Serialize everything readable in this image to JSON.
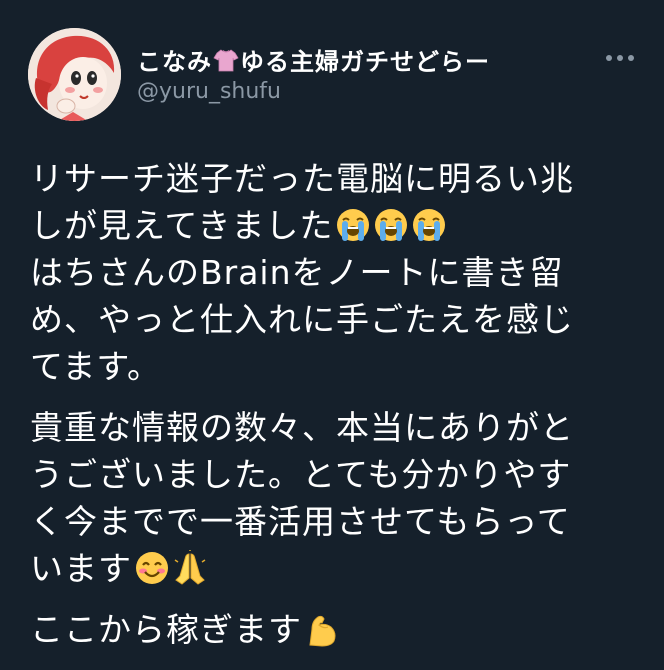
{
  "header": {
    "display_name_part1": "こなみ",
    "display_name_part2": "ゆる主婦ガチせどらー",
    "name_icon": "t-shirt-icon",
    "handle": "@yuru_shufu",
    "more_icon": "more-horizontal-icon"
  },
  "tweet": {
    "paragraphs": [
      {
        "lines": [
          {
            "text": "リサーチ迷子だった電脳に明るい兆"
          },
          {
            "text": "しが見えてきました",
            "emojis": [
              "loudly-crying-face-icon",
              "loudly-crying-face-icon",
              "loudly-crying-face-icon"
            ]
          },
          {
            "text": "はちさんのBrainをノートに書き留"
          },
          {
            "text": "め、やっと仕入れに手ごたえを感じ"
          },
          {
            "text": "てます。"
          }
        ]
      },
      {
        "lines": [
          {
            "text": "貴重な情報の数々、本当にありがと"
          },
          {
            "text": "うございました。とても分かりやす"
          },
          {
            "text": "く今までで一番活用させてもらって"
          },
          {
            "text": "います",
            "emojis": [
              "smiling-face-icon",
              "folded-hands-icon"
            ]
          }
        ]
      },
      {
        "lines": [
          {
            "text": "ここから稼ぎます",
            "emojis": [
              "flexed-biceps-icon"
            ]
          }
        ]
      }
    ]
  },
  "colors": {
    "background": "#15202b",
    "text": "#ffffff",
    "secondary_text": "#8b98a5"
  }
}
